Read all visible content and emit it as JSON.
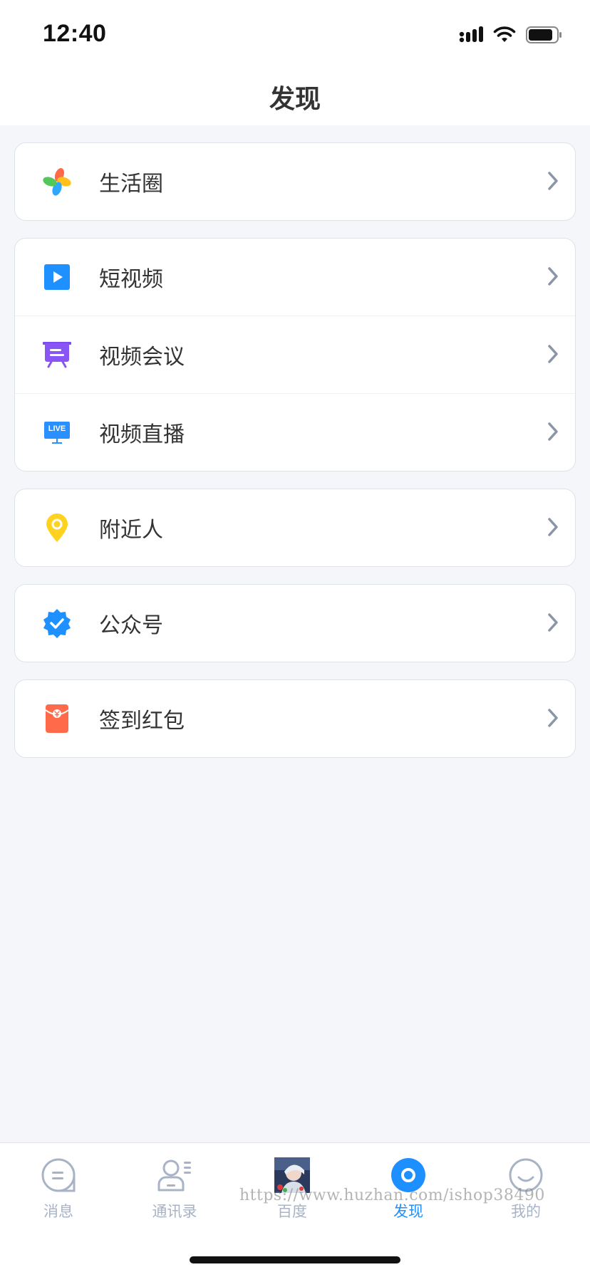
{
  "status_bar": {
    "time": "12:40",
    "icons": [
      "signal-icon",
      "wifi-icon",
      "battery-icon"
    ]
  },
  "nav": {
    "title": "发现"
  },
  "menu": {
    "groups": [
      {
        "items": [
          {
            "label": "生活圈",
            "icon": "pinwheel-icon"
          }
        ]
      },
      {
        "items": [
          {
            "label": "短视频",
            "icon": "play-icon"
          },
          {
            "label": "视频会议",
            "icon": "meeting-board-icon"
          },
          {
            "label": "视频直播",
            "icon": "live-icon",
            "icon_text": "LIVE"
          }
        ]
      },
      {
        "items": [
          {
            "label": "附近人",
            "icon": "location-pin-icon"
          }
        ]
      },
      {
        "items": [
          {
            "label": "公众号",
            "icon": "verified-badge-icon"
          }
        ]
      },
      {
        "items": [
          {
            "label": "签到红包",
            "icon": "red-envelope-icon"
          }
        ]
      }
    ]
  },
  "tab_bar": {
    "tabs": [
      {
        "label": "消息",
        "icon": "chat-bubble-icon",
        "active": false
      },
      {
        "label": "通讯录",
        "icon": "contacts-icon",
        "active": false
      },
      {
        "label": "百度",
        "icon": "avatar-thumbnail",
        "active": false
      },
      {
        "label": "发现",
        "icon": "discover-icon",
        "active": true
      },
      {
        "label": "我的",
        "icon": "smiley-icon",
        "active": false
      }
    ]
  },
  "watermark": "https://www.huzhan.com/ishop38490",
  "colors": {
    "accent": "#1e8fff",
    "tab_inactive": "#a8b3c6",
    "background": "#f5f6fa",
    "text": "#333333"
  }
}
